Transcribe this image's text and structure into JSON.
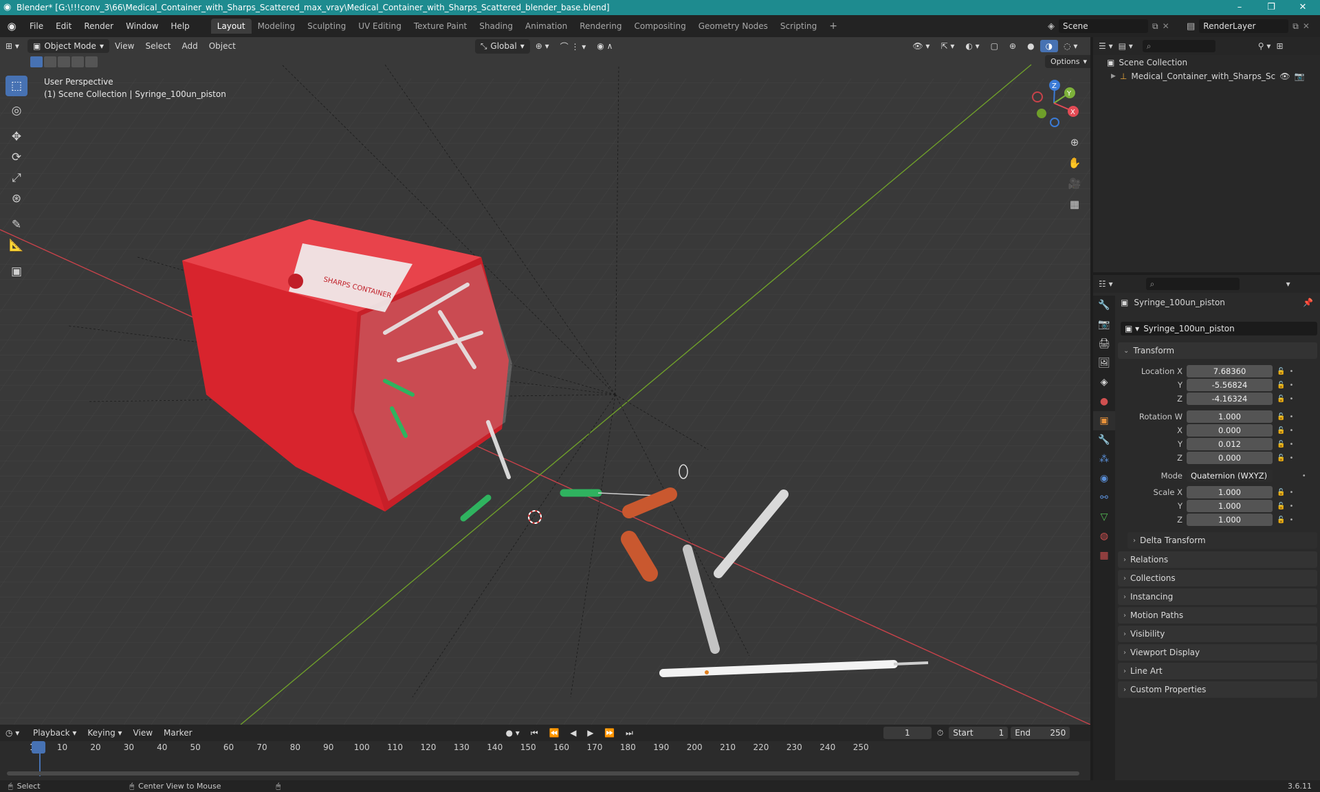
{
  "titlebar": {
    "title": "Blender* [G:\\!!!conv_3\\66\\Medical_Container_with_Sharps_Scattered_max_vray\\Medical_Container_with_Sharps_Scattered_blender_base.blend]",
    "minimize": "–",
    "maximize": "❐",
    "close": "✕"
  },
  "menubar": {
    "items": [
      "File",
      "Edit",
      "Render",
      "Window",
      "Help"
    ],
    "workspaces": [
      "Layout",
      "Modeling",
      "Sculpting",
      "UV Editing",
      "Texture Paint",
      "Shading",
      "Animation",
      "Rendering",
      "Compositing",
      "Geometry Nodes",
      "Scripting"
    ],
    "active_workspace": "Layout",
    "add_tab": "+",
    "scene": "Scene",
    "view_layer": "RenderLayer"
  },
  "viewport": {
    "mode": "Object Mode",
    "menus": [
      "View",
      "Select",
      "Add",
      "Object"
    ],
    "orientation": "Global",
    "options": "Options",
    "overlay_line1": "User Perspective",
    "overlay_line2": "(1) Scene Collection | Syringe_100un_piston",
    "label_text": "SHARPS CONTAINER",
    "axis_labels": {
      "x": "X",
      "y": "Y",
      "z": "Z"
    },
    "colors": {
      "bg": "#393939",
      "x_axis": "#c8424a",
      "y_axis": "#6f9f2a",
      "container": "#d8242d"
    }
  },
  "outliner": {
    "root": "Scene Collection",
    "child": "Medical_Container_with_Sharps_Scatter"
  },
  "properties": {
    "object_name": "Syringe_100un_piston",
    "data_name": "Syringe_100un_piston",
    "transform_header": "Transform",
    "location": {
      "label": "Location X",
      "x": "7.68360",
      "y": "-5.56824",
      "z": "-4.16324"
    },
    "rotation": {
      "label": "Rotation W",
      "w": "1.000",
      "x": "0.000",
      "y": "0.012",
      "z": "0.000"
    },
    "axis_y": "Y",
    "axis_z": "Z",
    "axis_x": "X",
    "mode_label": "Mode",
    "mode_value": "Quaternion (WXYZ)",
    "scale": {
      "label": "Scale X",
      "x": "1.000",
      "y": "1.000",
      "z": "1.000"
    },
    "delta": "Delta Transform",
    "panels": [
      "Relations",
      "Collections",
      "Instancing",
      "Motion Paths",
      "Visibility",
      "Viewport Display",
      "Line Art",
      "Custom Properties"
    ]
  },
  "timeline": {
    "menus": [
      "Playback",
      "Keying",
      "View",
      "Marker"
    ],
    "current_frame": "1",
    "start_label": "Start",
    "start": "1",
    "end_label": "End",
    "end": "250",
    "ticks": [
      "1",
      "10",
      "20",
      "30",
      "40",
      "50",
      "60",
      "70",
      "80",
      "90",
      "100",
      "110",
      "120",
      "130",
      "140",
      "150",
      "160",
      "170",
      "180",
      "190",
      "200",
      "210",
      "220",
      "230",
      "240",
      "250"
    ]
  },
  "statusbar": {
    "select": "Select",
    "center": "Center View to Mouse",
    "version": "3.6.11"
  }
}
